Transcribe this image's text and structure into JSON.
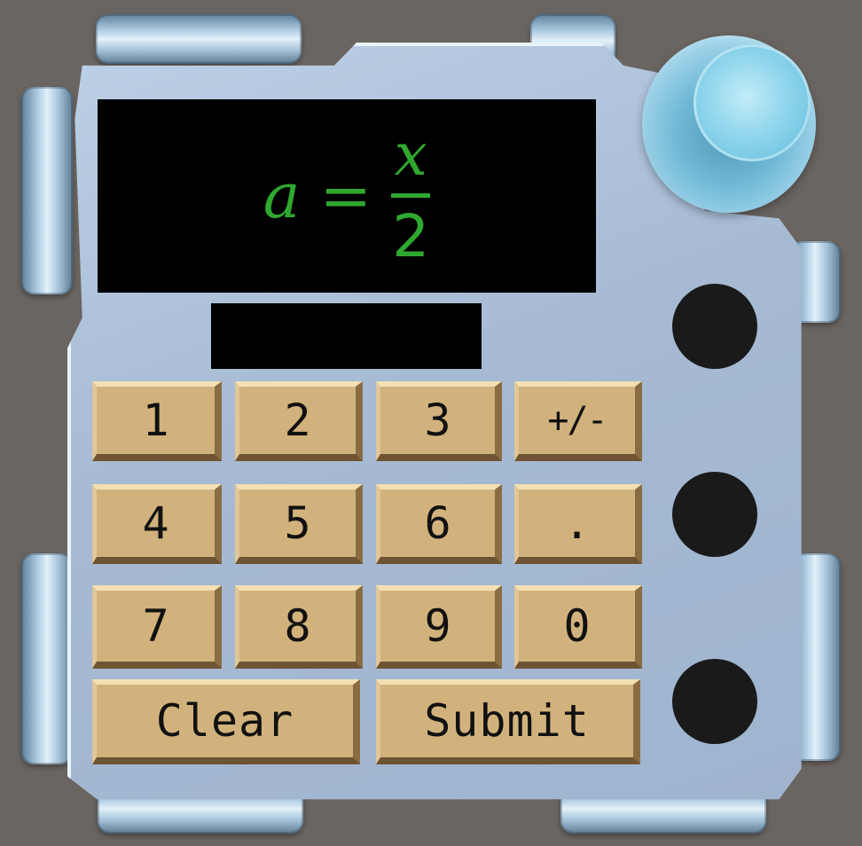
{
  "display": {
    "formula": {
      "lhs": "a",
      "equals": "=",
      "numerator": "x",
      "denominator": "2"
    },
    "input_value": ""
  },
  "keypad": {
    "rows": [
      [
        "1",
        "2",
        "3",
        "+/-"
      ],
      [
        "4",
        "5",
        "6",
        "."
      ],
      [
        "7",
        "8",
        "9",
        "0"
      ]
    ],
    "clear_label": "Clear",
    "submit_label": "Submit"
  },
  "indicators": {
    "count": 3,
    "color": "#1a1a1a"
  },
  "colors": {
    "background": "#6b6561",
    "display_text": "#2fa82f",
    "key_face": "#d2b27c",
    "panel": "#a6bad3",
    "knob": "#8fd5ec"
  }
}
